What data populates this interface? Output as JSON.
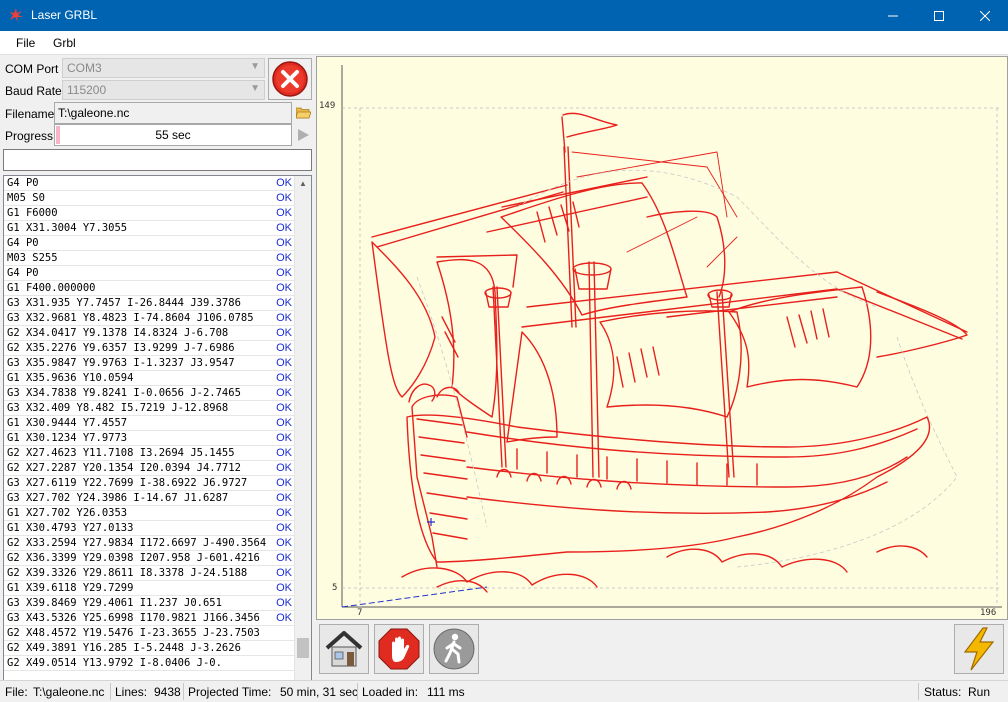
{
  "window": {
    "title": "Laser GRBL"
  },
  "menu": {
    "file": "File",
    "grbl": "Grbl"
  },
  "connection": {
    "com_label": "COM Port",
    "com_value": "COM3",
    "baud_label": "Baud Rate",
    "baud_value": "115200"
  },
  "file": {
    "filename_label": "Filename",
    "filename_value": "T:\\galeone.nc"
  },
  "progress": {
    "label": "Progress",
    "text": "55 sec",
    "fraction": 0.01
  },
  "console": {
    "rows": [
      {
        "cmd": "G4 P0",
        "status": "OK"
      },
      {
        "cmd": "M05 S0",
        "status": "OK"
      },
      {
        "cmd": "G1 F6000",
        "status": "OK"
      },
      {
        "cmd": "G1 X31.3004 Y7.3055",
        "status": "OK"
      },
      {
        "cmd": "G4 P0",
        "status": "OK"
      },
      {
        "cmd": "M03 S255",
        "status": "OK"
      },
      {
        "cmd": "G4 P0",
        "status": "OK"
      },
      {
        "cmd": "G1 F400.000000",
        "status": "OK"
      },
      {
        "cmd": "G3 X31.935 Y7.7457 I-26.8444 J39.3786",
        "status": "OK"
      },
      {
        "cmd": "G3 X32.9681 Y8.4823 I-74.8604 J106.0785",
        "status": "OK"
      },
      {
        "cmd": "G2 X34.0417 Y9.1378 I4.8324 J-6.708",
        "status": "OK"
      },
      {
        "cmd": "G2 X35.2276 Y9.6357 I3.9299 J-7.6986",
        "status": "OK"
      },
      {
        "cmd": "G3 X35.9847 Y9.9763 I-1.3237 J3.9547",
        "status": "OK"
      },
      {
        "cmd": "G1 X35.9636 Y10.0594",
        "status": "OK"
      },
      {
        "cmd": "G3 X34.7838 Y9.8241 I-0.0656 J-2.7465",
        "status": "OK"
      },
      {
        "cmd": "G3 X32.409 Y8.482 I5.7219 J-12.8968",
        "status": "OK"
      },
      {
        "cmd": "G1 X30.9444 Y7.4557",
        "status": "OK"
      },
      {
        "cmd": "G1 X30.1234 Y7.9773",
        "status": "OK"
      },
      {
        "cmd": "G2 X27.4623 Y11.7108 I3.2694 J5.1455",
        "status": "OK"
      },
      {
        "cmd": "G2 X27.2287 Y20.1354 I20.0394 J4.7712",
        "status": "OK"
      },
      {
        "cmd": "G3 X27.6119 Y22.7699 I-38.6922 J6.9727",
        "status": "OK"
      },
      {
        "cmd": "G3 X27.702 Y24.3986 I-14.67 J1.6287",
        "status": "OK"
      },
      {
        "cmd": "G1 X27.702 Y26.0353",
        "status": "OK"
      },
      {
        "cmd": "G1 X30.4793 Y27.0133",
        "status": "OK"
      },
      {
        "cmd": "G2 X33.2594 Y27.9834 I172.6697 J-490.3564",
        "status": "OK"
      },
      {
        "cmd": "G2 X36.3399 Y29.0398 I207.958 J-601.4216",
        "status": "OK"
      },
      {
        "cmd": "G2 X39.3326 Y29.8611 I8.3378 J-24.5188",
        "status": "OK"
      },
      {
        "cmd": "G1 X39.6118 Y29.7299",
        "status": "OK"
      },
      {
        "cmd": "G3 X39.8469 Y29.4061 I1.237 J0.651",
        "status": "OK"
      },
      {
        "cmd": "G3 X43.5326 Y25.6998 I170.9821 J166.3456",
        "status": "OK"
      },
      {
        "cmd": "G2 X48.4572 Y19.5476 I-23.3655 J-23.7503",
        "status": ""
      },
      {
        "cmd": "G2 X49.3891 Y16.285 I-5.2448 J-3.2626",
        "status": ""
      },
      {
        "cmd": "G2 X49.0514 Y13.9792 I-8.0406 J-0.",
        "status": ""
      }
    ]
  },
  "canvas": {
    "y_max_label": "149",
    "y_min_label": "5",
    "x_min_label": "7",
    "x_max_label": "196"
  },
  "status": {
    "file_label": "File:",
    "file_value": "T:\\galeone.nc",
    "lines_label": "Lines:",
    "lines_value": "9438",
    "projected_label": "Projected Time:",
    "projected_value": "50 min, 31 sec",
    "loaded_label": "Loaded in:",
    "loaded_value": "111 ms",
    "status_label": "Status:",
    "status_value": "Run"
  },
  "icons": {
    "app": "laser-icon",
    "disconnect": "red-x-icon",
    "open": "folder-icon",
    "run": "play-icon",
    "home": "home-icon",
    "stop": "stop-hand-icon",
    "unlock": "walking-man-icon",
    "laser": "lightning-icon"
  }
}
